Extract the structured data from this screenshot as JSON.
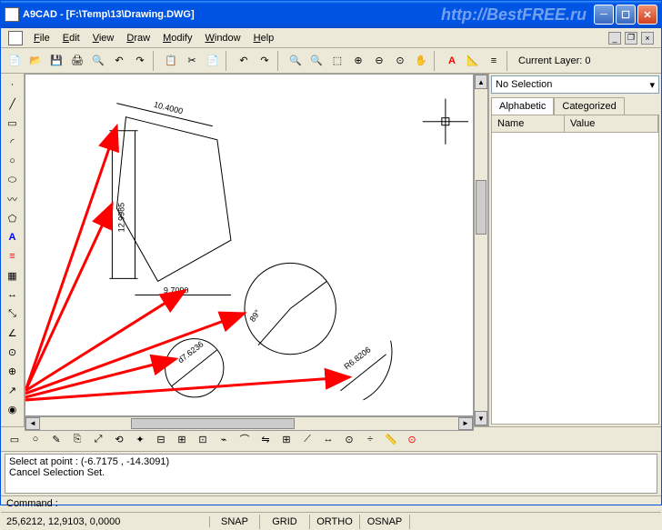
{
  "title": "A9CAD - [F:\\Temp\\13\\Drawing.DWG]",
  "watermark": "http://BestFREE.ru",
  "menu": [
    "File",
    "Edit",
    "View",
    "Draw",
    "Modify",
    "Window",
    "Help"
  ],
  "layer_label": "Current Layer: 0",
  "right": {
    "selection": "No Selection",
    "tabs": [
      "Alphabetic",
      "Categorized"
    ],
    "cols": [
      "Name",
      "Value"
    ]
  },
  "cmd": {
    "line1": "Select at point : (-6.7175 , -14.3091)",
    "line2": "Cancel Selection Set.",
    "prompt": "Command :"
  },
  "status": {
    "coord": "25,6212, 12,9103, 0,0000",
    "panes": [
      "SNAP",
      "GRID",
      "ORTHO",
      "OSNAP"
    ]
  },
  "dims": {
    "d1": "10.4000",
    "d2": "12.9985",
    "d3": "9.7090",
    "d4": "d7.6236",
    "d5": "89°",
    "d6": "R6.8206"
  }
}
